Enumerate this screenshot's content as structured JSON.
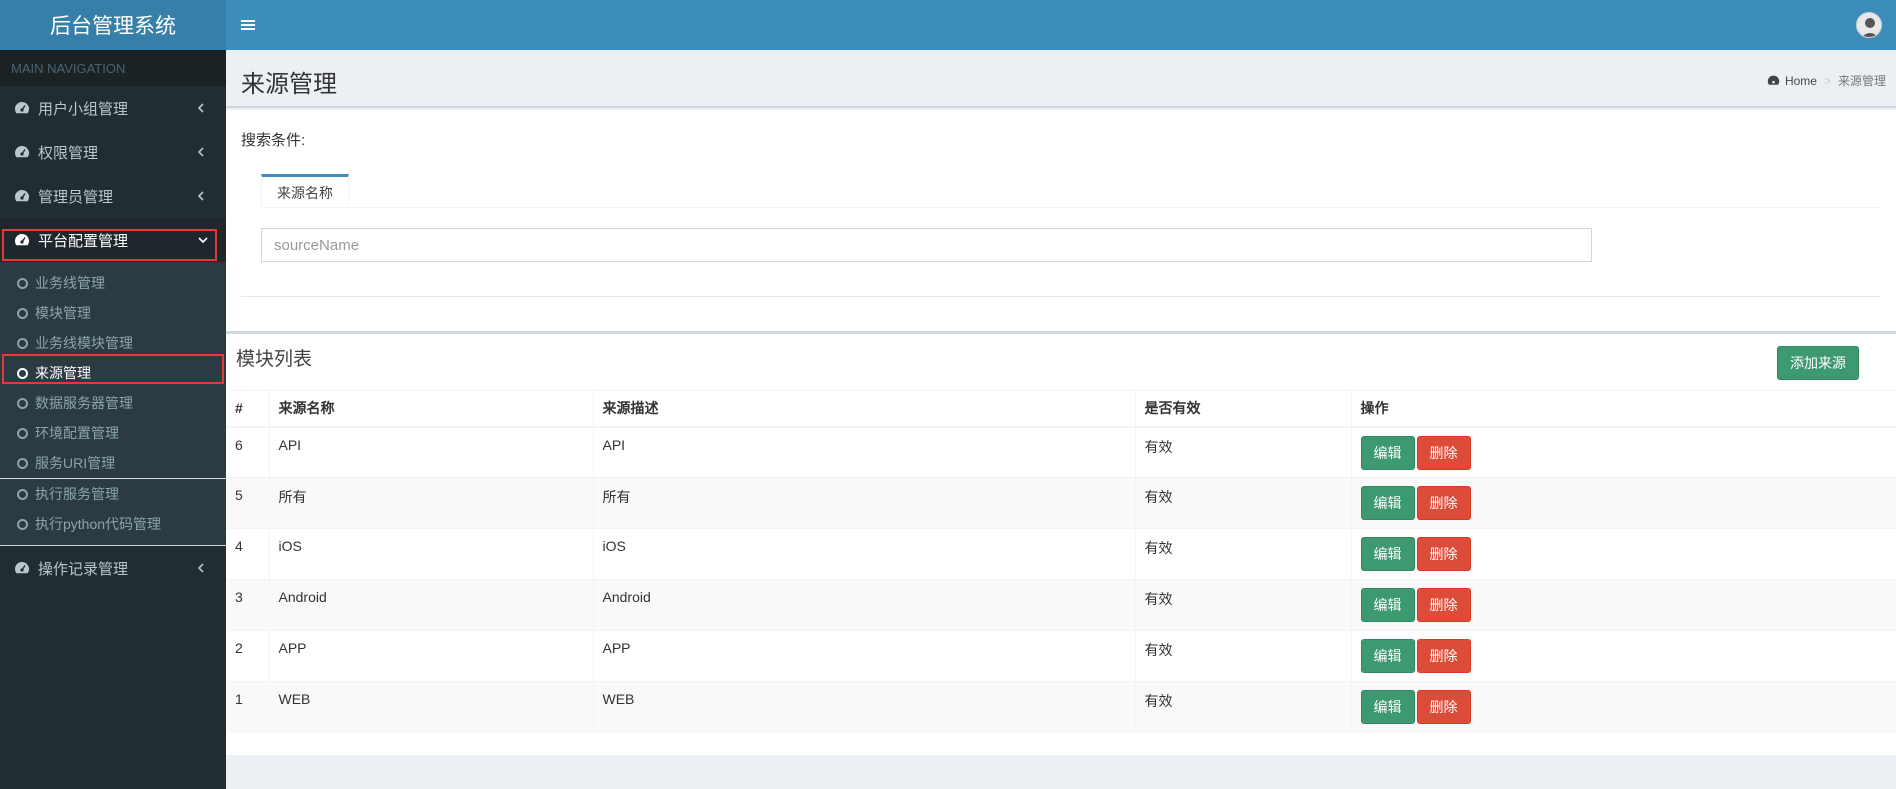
{
  "app": {
    "title": "后台管理系统"
  },
  "sidebar": {
    "header": "MAIN NAVIGATION",
    "items": [
      {
        "label": "用户小组管理",
        "icon": "dashboard-icon",
        "expanded": false
      },
      {
        "label": "权限管理",
        "icon": "dashboard-icon",
        "expanded": false
      },
      {
        "label": "管理员管理",
        "icon": "dashboard-icon",
        "expanded": false
      },
      {
        "label": "平台配置管理",
        "icon": "dashboard-icon",
        "expanded": true
      },
      {
        "label": "操作记录管理",
        "icon": "dashboard-icon",
        "expanded": false
      }
    ],
    "subitems": [
      {
        "label": "业务线管理"
      },
      {
        "label": "模块管理"
      },
      {
        "label": "业务线模块管理"
      },
      {
        "label": "来源管理",
        "active": true
      },
      {
        "label": "数据服务器管理"
      },
      {
        "label": "环境配置管理"
      },
      {
        "label": "服务URI管理"
      },
      {
        "label": "执行服务管理"
      },
      {
        "label": "执行python代码管理"
      }
    ]
  },
  "header": {
    "toggle_icon": "menu-icon",
    "avatar": "user-avatar"
  },
  "page": {
    "title": "来源管理",
    "breadcrumb": {
      "home": "Home",
      "current": "来源管理"
    }
  },
  "search": {
    "label": "搜索条件:",
    "tab": "来源名称",
    "placeholder": "sourceName",
    "value": ""
  },
  "list": {
    "title": "模块列表",
    "add_label": "添加来源",
    "columns": [
      "#",
      "来源名称",
      "来源描述",
      "是否有效",
      "操作"
    ],
    "rows": [
      {
        "id": "6",
        "name": "API",
        "desc": "API",
        "valid": "有效"
      },
      {
        "id": "5",
        "name": "所有",
        "desc": "所有",
        "valid": "有效"
      },
      {
        "id": "4",
        "name": "iOS",
        "desc": "iOS",
        "valid": "有效"
      },
      {
        "id": "3",
        "name": "Android",
        "desc": "Android",
        "valid": "有效"
      },
      {
        "id": "2",
        "name": "APP",
        "desc": "APP",
        "valid": "有效"
      },
      {
        "id": "1",
        "name": "WEB",
        "desc": "WEB",
        "valid": "有效"
      }
    ],
    "edit_label": "编辑",
    "delete_label": "删除"
  },
  "colors": {
    "navbar": "#3c8dbc",
    "logo": "#367fa9",
    "sidebar": "#222d32",
    "success": "#3d9970",
    "danger": "#dd4b39",
    "highlight": "#e53935"
  }
}
